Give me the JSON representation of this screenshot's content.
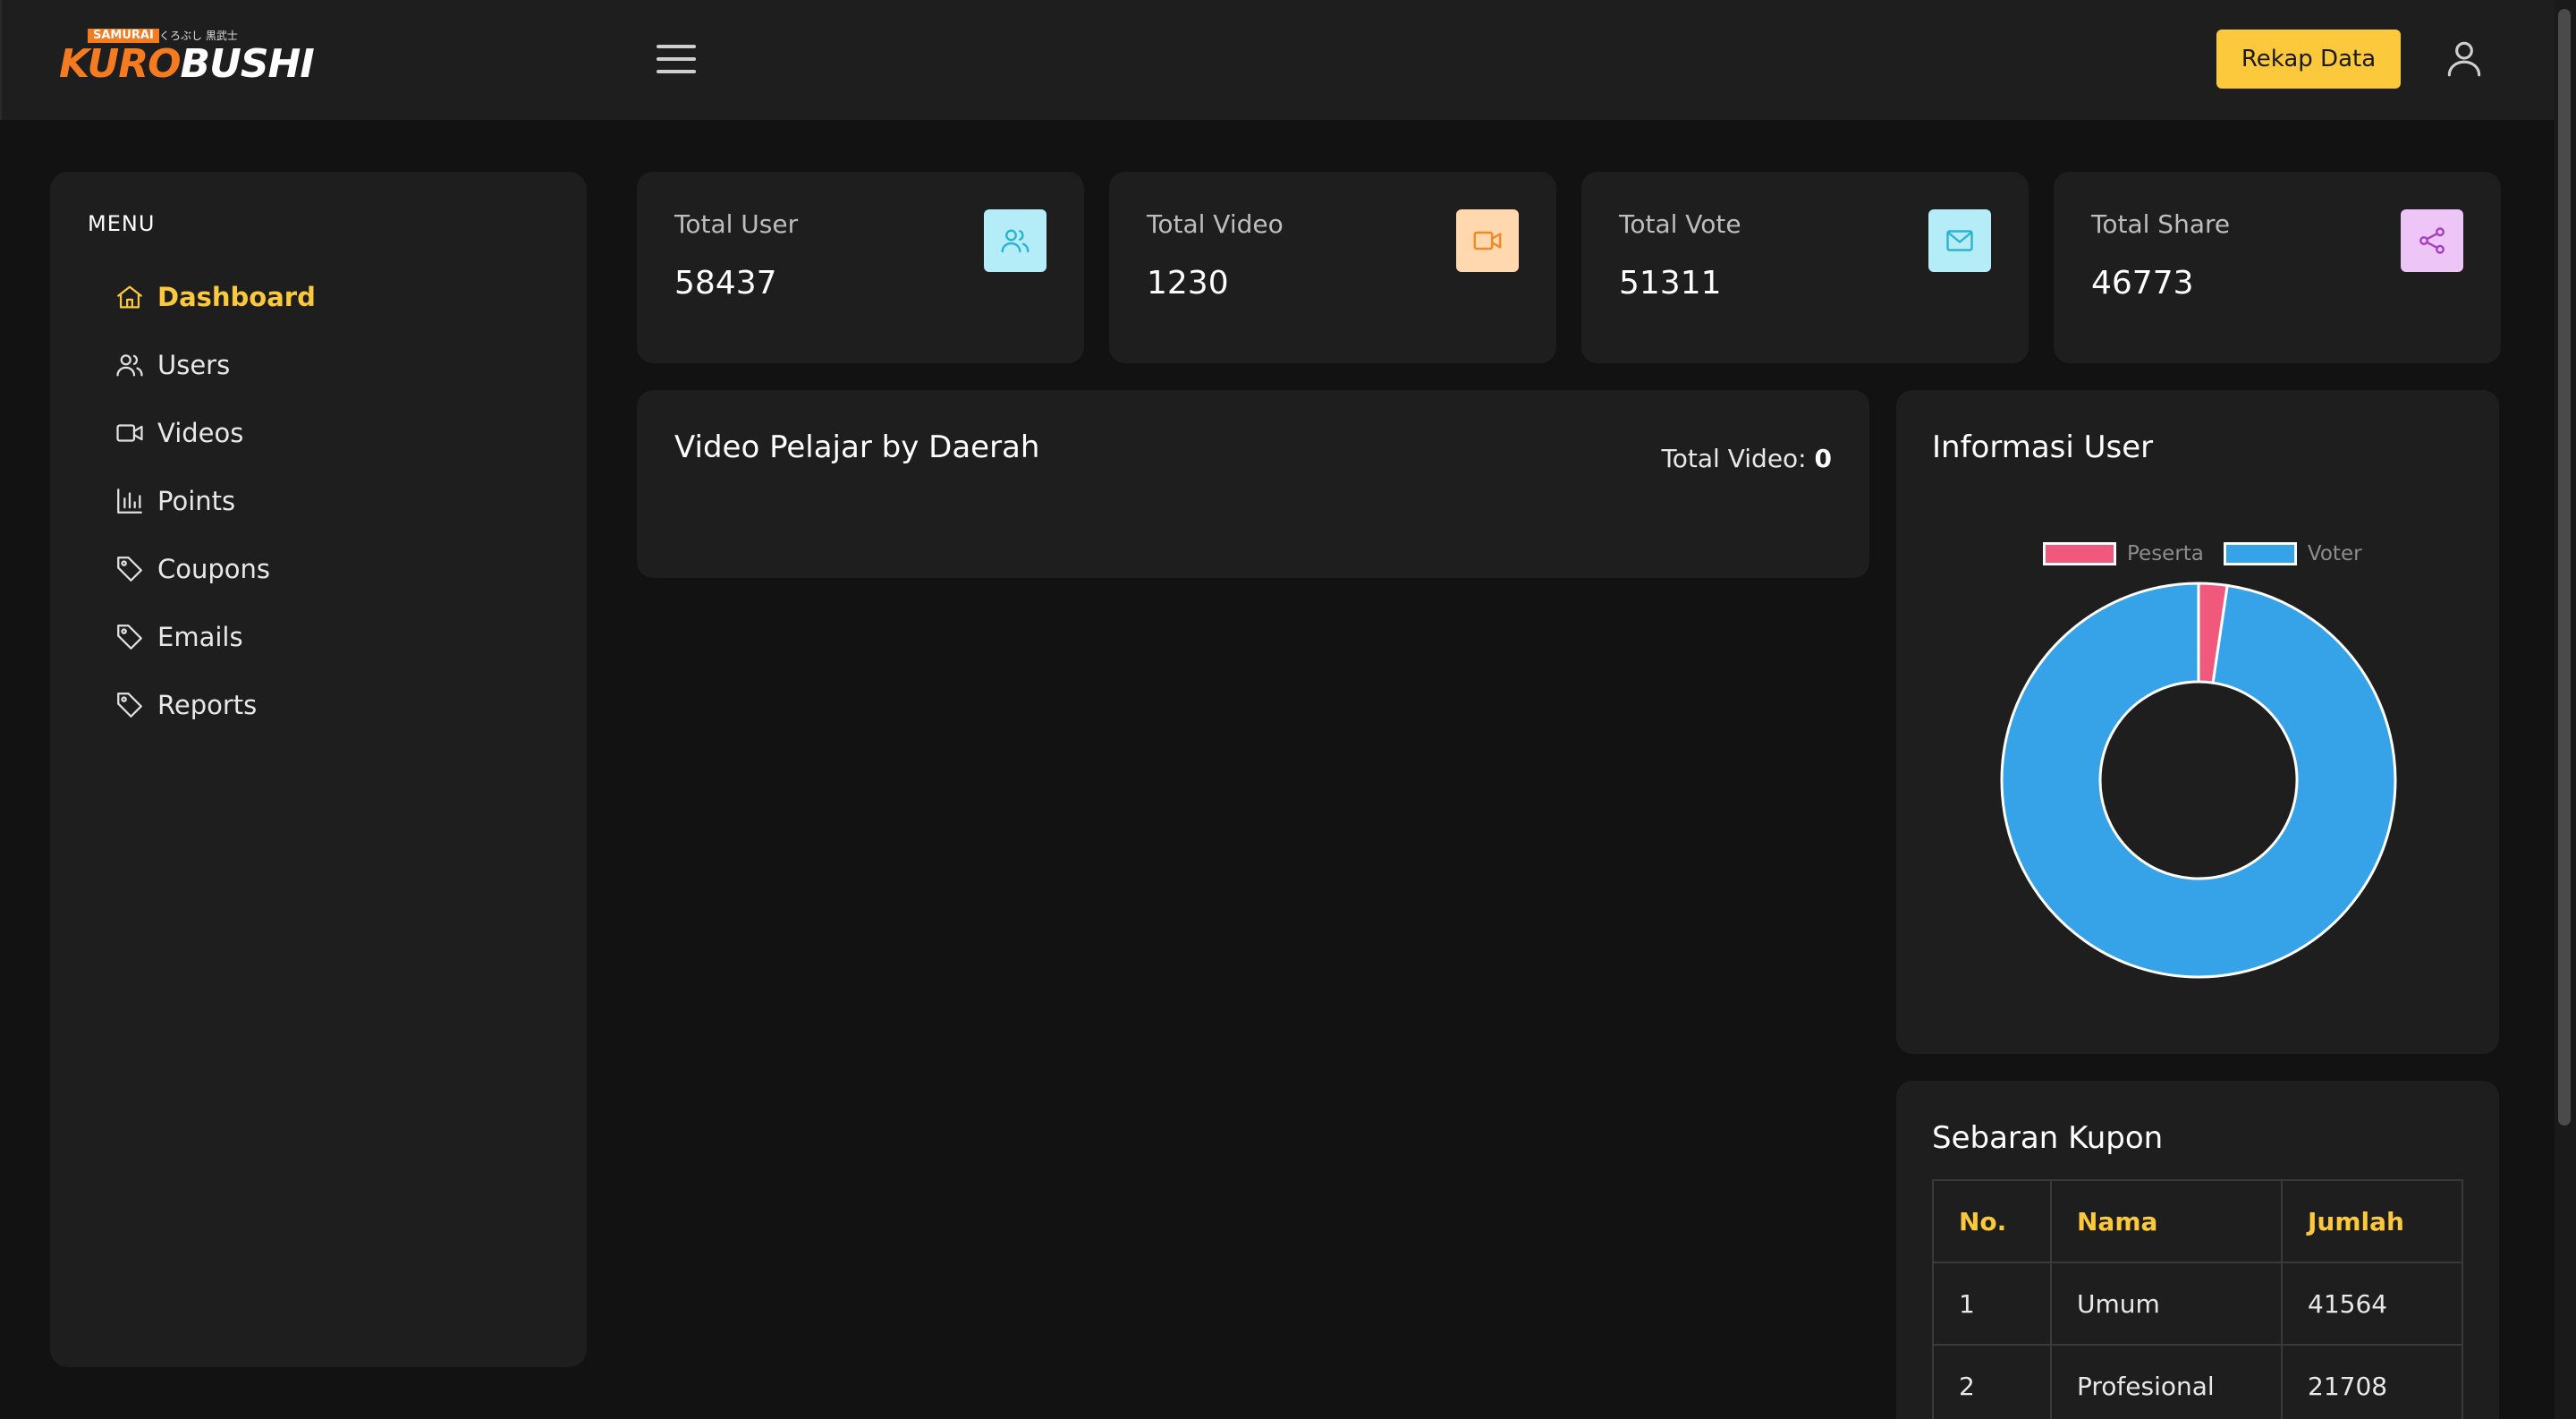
{
  "header": {
    "logo_tag": "SAMURAI",
    "logo_jp": "くろぶし 黒武士",
    "logo_part1": "KURO",
    "logo_part2": "BUSHI",
    "rekap_label": "Rekap Data"
  },
  "sidebar": {
    "menu_title": "MENU",
    "items": [
      {
        "label": "Dashboard",
        "icon": "home-icon",
        "active": true
      },
      {
        "label": "Users",
        "icon": "users-icon"
      },
      {
        "label": "Videos",
        "icon": "video-icon"
      },
      {
        "label": "Points",
        "icon": "bar-chart-icon"
      },
      {
        "label": "Coupons",
        "icon": "tag-icon"
      },
      {
        "label": "Emails",
        "icon": "tag-icon"
      },
      {
        "label": "Reports",
        "icon": "tag-icon"
      }
    ]
  },
  "stats": [
    {
      "label": "Total User",
      "value": "58437",
      "icon": "users-icon",
      "color": "#2bb3d1",
      "bg": "#b4ecf7"
    },
    {
      "label": "Total Video",
      "value": "1230",
      "icon": "video-icon",
      "color": "#f08a24",
      "bg": "#ffd8b0"
    },
    {
      "label": "Total Vote",
      "value": "51311",
      "icon": "mail-icon",
      "color": "#2bb3d1",
      "bg": "#b4ecf7"
    },
    {
      "label": "Total Share",
      "value": "46773",
      "icon": "share-icon",
      "color": "#a63fc0",
      "bg": "#eec5f7"
    }
  ],
  "video_panel": {
    "title": "Video Pelajar by Daerah",
    "total_label": "Total Video: ",
    "total_value": "0"
  },
  "info_user": {
    "title": "Informasi User"
  },
  "chart_data": {
    "type": "pie",
    "donut": true,
    "categories": [
      "Peserta",
      "Voter"
    ],
    "values": [
      1230,
      51311
    ],
    "colors": [
      "#f0587c",
      "#36a2e8"
    ],
    "legend_position": "top"
  },
  "kupon": {
    "title": "Sebaran Kupon",
    "headers": [
      "No.",
      "Nama",
      "Jumlah"
    ],
    "rows": [
      [
        "1",
        "Umum",
        "41564"
      ],
      [
        "2",
        "Profesional",
        "21708"
      ]
    ]
  },
  "colors": {
    "accent": "#fcc93c",
    "panel": "#1e1e1e",
    "background": "#121212"
  }
}
